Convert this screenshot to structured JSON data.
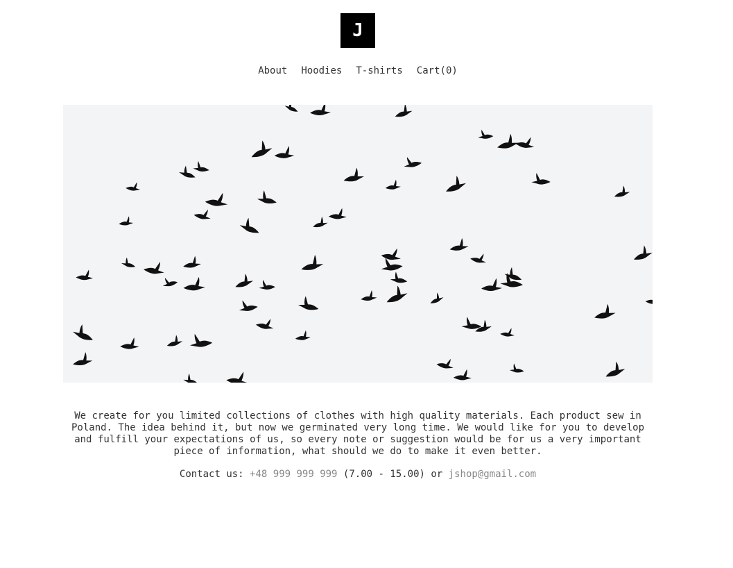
{
  "brand": {
    "logo_letter": "J"
  },
  "nav": {
    "items": [
      {
        "label": "About"
      },
      {
        "label": "Hoodies"
      },
      {
        "label": "T-shirts"
      },
      {
        "label": "Cart(0)"
      }
    ]
  },
  "hero": {
    "image": "flock-of-birds-photo"
  },
  "about": {
    "text": "We create for you limited collections of clothes with high quality materials. Each product sew in Poland. The idea behind it, but now we germinated very long time. We would like for you to develop and fulfill your expectations of us, so every note or suggestion would be for us a very important piece of information, what should we do to make it even better."
  },
  "contact": {
    "prefix": "Contact us:",
    "phone": "+48 999 999 999",
    "hours": "(7.00 - 15.00) or",
    "email": "jshop@gmail.com"
  },
  "colors": {
    "background": "#ffffff",
    "text": "#333333",
    "link_muted": "#888888",
    "logo_bg": "#000000",
    "hero_bg": "#f3f4f6"
  }
}
